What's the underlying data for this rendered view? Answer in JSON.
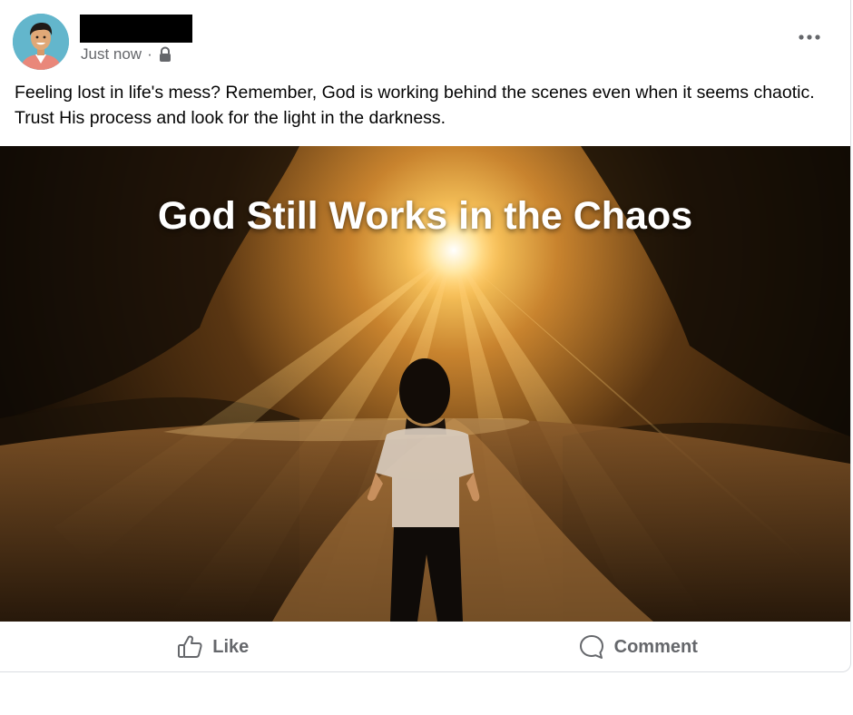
{
  "post": {
    "timestamp": "Just now",
    "separator": "·",
    "privacy_icon": "lock-icon",
    "more_icon": "more-options-icon",
    "text": "Feeling lost in life's mess? Remember, God is working behind the scenes even when it seems chaotic. Trust His process and look for the light in the darkness.",
    "image": {
      "overlay_title": "God Still Works in the Chaos"
    }
  },
  "actions": {
    "like_label": "Like",
    "like_icon": "thumbs-up-icon",
    "comment_label": "Comment",
    "comment_icon": "comment-bubble-icon"
  },
  "colors": {
    "text_primary": "#050505",
    "text_secondary": "#65676b",
    "divider": "#dadde1"
  }
}
